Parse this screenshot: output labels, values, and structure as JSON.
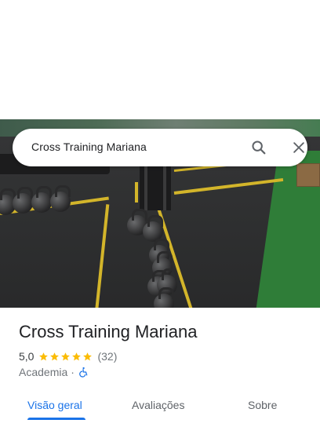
{
  "search": {
    "query": "Cross Training Mariana",
    "search_icon": "search-icon",
    "close_icon": "close-icon"
  },
  "place": {
    "name": "Cross Training Mariana",
    "rating": "5,0",
    "star_count": 5,
    "review_count": "(32)",
    "category": "Academia",
    "separator": "·",
    "accessibility_icon": "wheelchair-icon"
  },
  "tabs": [
    {
      "label": "Visão geral",
      "active": true
    },
    {
      "label": "Avaliações",
      "active": false
    },
    {
      "label": "Sobre",
      "active": false
    }
  ],
  "colors": {
    "accent": "#1a73e8",
    "star": "#fbbc04",
    "text_primary": "#202124",
    "text_secondary": "#70757a"
  }
}
